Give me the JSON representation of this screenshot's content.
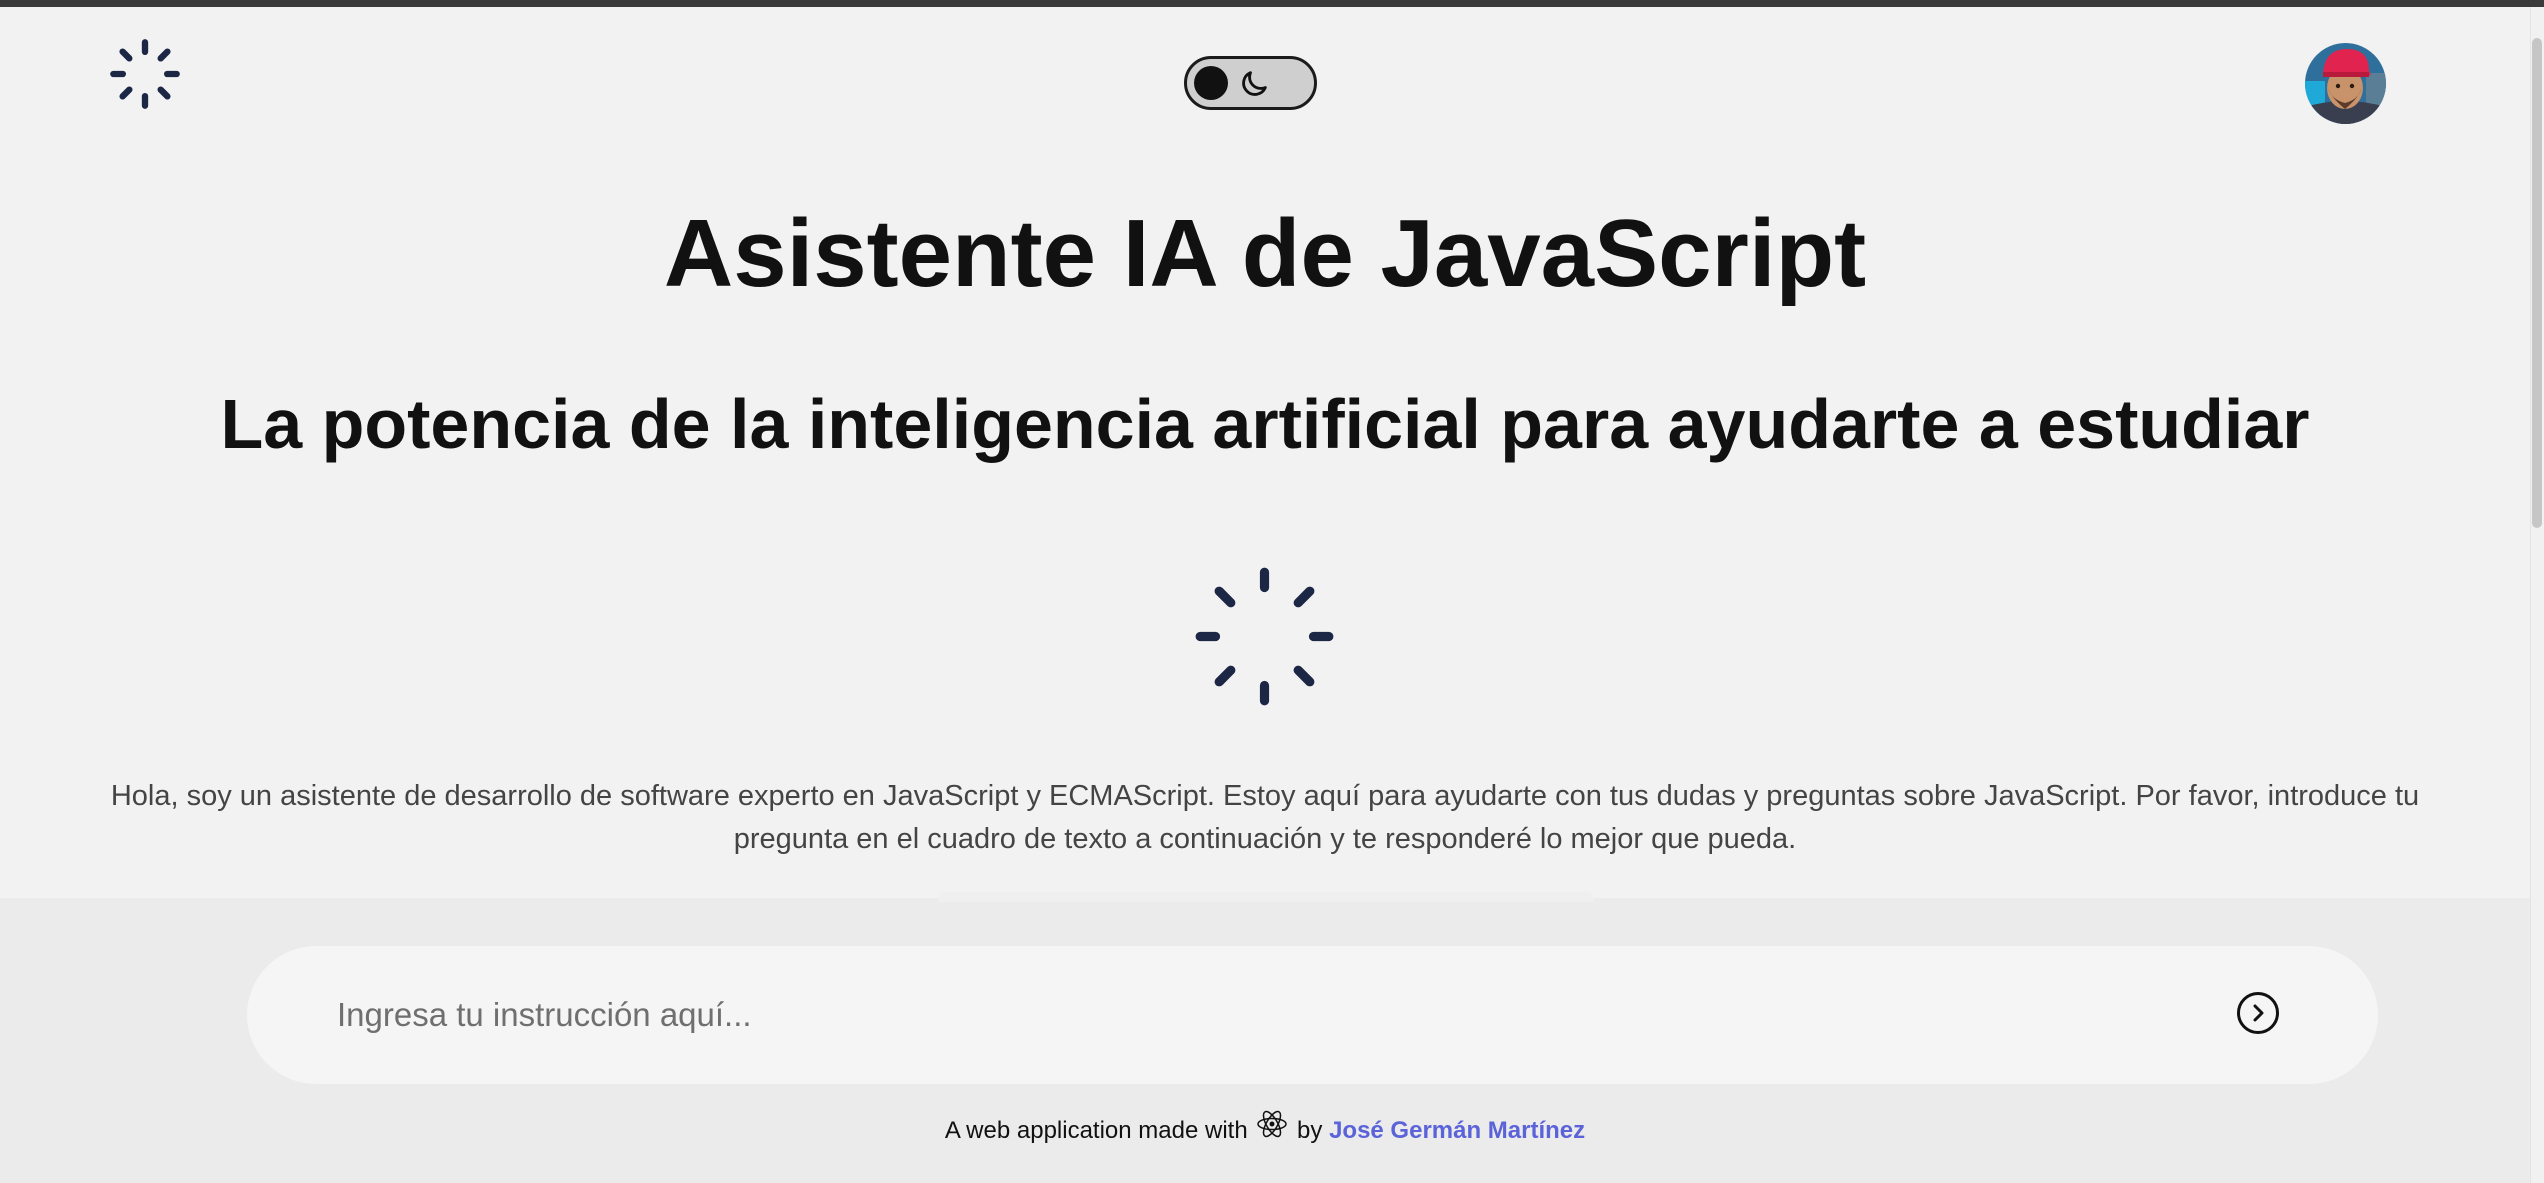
{
  "header": {
    "logo_icon": "loader-icon",
    "theme_toggle_icon": "moon-icon",
    "avatar_alt": "user-avatar"
  },
  "main": {
    "title": "Asistente IA de JavaScript",
    "subtitle": "La potencia de la inteligencia artificial para ayudarte a estudiar",
    "intro": "Hola, soy un asistente de desarrollo de software experto en JavaScript y ECMAScript. Estoy aquí para ayudarte con tus dudas y preguntas sobre JavaScript. Por favor, introduce tu pregunta en el cuadro de texto a continuación y te responderé lo mejor que pueda."
  },
  "composer": {
    "placeholder": "Ingresa tu instrucción aquí...",
    "value": "",
    "send_icon": "chevron-right-circle-icon"
  },
  "footer": {
    "prefix": "A web application made with",
    "react_icon": "react-icon",
    "by": "by",
    "author": "José Germán Martínez"
  },
  "colors": {
    "background": "#f2f2f2",
    "composer_area": "#ebebeb",
    "spinner": "#1c2645",
    "link": "#5b63d9"
  }
}
